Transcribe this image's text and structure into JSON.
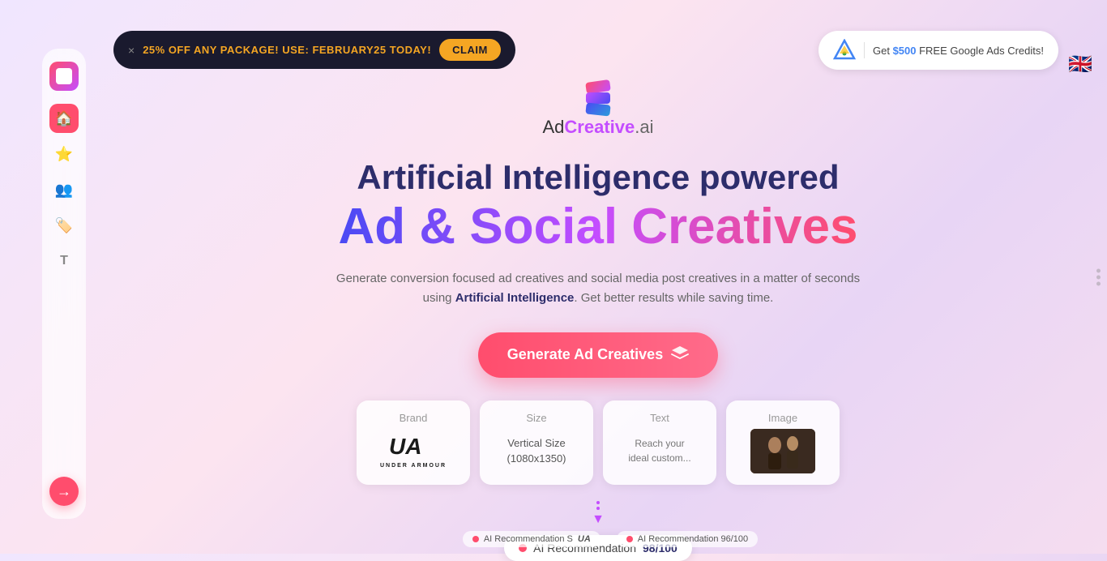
{
  "promo": {
    "close_label": "×",
    "text": "25% OFF ANY PACKAGE! USE:",
    "code": "FEBRUARY25",
    "suffix": "TODAY!",
    "claim_label": "CLAIM"
  },
  "google_banner": {
    "text_prefix": "Get ",
    "amount": "$500",
    "text_suffix": " FREE Google Ads Credits!"
  },
  "sidebar": {
    "items": [
      {
        "icon": "🏠",
        "label": "home",
        "active": true
      },
      {
        "icon": "⭐",
        "label": "favorites",
        "active": false
      },
      {
        "icon": "👥",
        "label": "team",
        "active": false
      },
      {
        "icon": "🏷️",
        "label": "tags",
        "active": false
      },
      {
        "icon": "T",
        "label": "text",
        "active": false
      }
    ],
    "action_button": "→"
  },
  "hero": {
    "logo_text_ad": "Ad",
    "logo_text_creative": "Creative",
    "logo_text_ai": ".ai",
    "headline_line1": "Artificial Intelligence powered",
    "headline_line2": "Ad & Social Creatives",
    "subtitle": "Generate conversion focused ad creatives and social media post creatives in a matter of seconds using",
    "subtitle_bold": "Artificial Intelligence",
    "subtitle_end": ". Get better results while saving time.",
    "generate_btn_label": "Generate Ad Creatives"
  },
  "feature_cards": [
    {
      "label": "Brand",
      "brand_name": "UNDER ARMOUR",
      "brand_subtitle": "UNDER ARMOUR"
    },
    {
      "label": "Size",
      "size_line1": "Vertical Size",
      "size_line2": "(1080x1350)"
    },
    {
      "label": "Text",
      "text_line1": "Reach your",
      "text_line2": "ideal custom..."
    },
    {
      "label": "Image",
      "image_desc": "product image"
    }
  ],
  "ai_recommendation": {
    "label": "AI Recommendation",
    "score": "98",
    "total": "/100"
  },
  "bottom_strip": [
    {
      "label": "AI Recommendation",
      "score": "S",
      "brand": "Under Armour"
    },
    {
      "label": "AI Recommendation 96/100"
    }
  ]
}
